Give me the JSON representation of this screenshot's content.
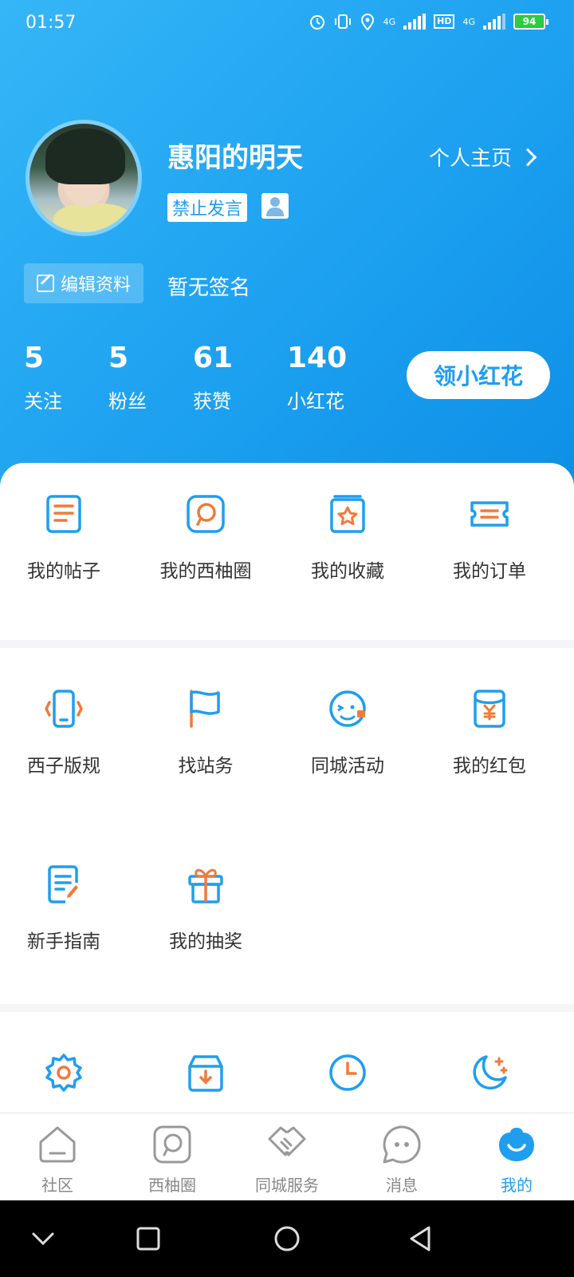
{
  "status_bar": {
    "time": "01:57",
    "network_label_1": "4G",
    "hd_label": "HD",
    "network_label_2": "4G",
    "battery": "94"
  },
  "profile": {
    "username": "惠阳的明天",
    "homepage_link": "个人主页",
    "ban_badge": "禁止发言",
    "edit_button": "编辑资料",
    "signature": "暂无签名"
  },
  "stats": [
    {
      "value": "5",
      "label": "关注"
    },
    {
      "value": "5",
      "label": "粉丝"
    },
    {
      "value": "61",
      "label": "获赞"
    },
    {
      "value": "140",
      "label": "小红花"
    }
  ],
  "flower_button": "领小红花",
  "primary_menu": [
    {
      "label": "我的帖子",
      "icon": "posts-icon"
    },
    {
      "label": "我的西柚圈",
      "icon": "circle-icon"
    },
    {
      "label": "我的收藏",
      "icon": "favorites-icon"
    },
    {
      "label": "我的订单",
      "icon": "orders-icon"
    }
  ],
  "service_menu": [
    {
      "label": "西子版规",
      "icon": "rules-icon"
    },
    {
      "label": "找站务",
      "icon": "flag-icon"
    },
    {
      "label": "同城活动",
      "icon": "activity-icon"
    },
    {
      "label": "我的红包",
      "icon": "red-packet-icon"
    },
    {
      "label": "新手指南",
      "icon": "guide-icon"
    },
    {
      "label": "我的抽奖",
      "icon": "gift-icon"
    }
  ],
  "settings_icons": [
    "gear-icon",
    "download-icon",
    "clock-icon",
    "moon-icon"
  ],
  "tabbar": [
    {
      "label": "社区",
      "icon": "home-icon"
    },
    {
      "label": "西柚圈",
      "icon": "circle-tab-icon"
    },
    {
      "label": "同城服务",
      "icon": "handshake-icon"
    },
    {
      "label": "消息",
      "icon": "message-icon"
    },
    {
      "label": "我的",
      "icon": "me-icon",
      "active": true
    }
  ],
  "colors": {
    "primary": "#1f9ef0",
    "accent": "#f07a3a",
    "header_gradient_start": "#35b6f7",
    "header_gradient_end": "#0d8fe6"
  }
}
